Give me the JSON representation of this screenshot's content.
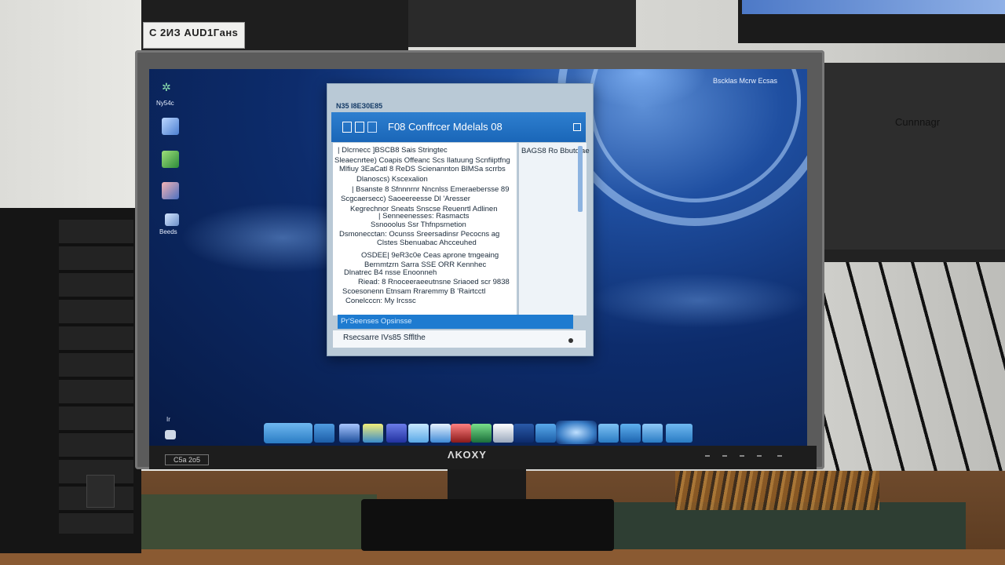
{
  "background": {
    "sticker_text": "C 2ИЗ АUD1Гaнs",
    "right_box_label": "Cunnnagr"
  },
  "monitor": {
    "brand": "ΛΚΟΧΥ",
    "model_label": "C5a 2o5"
  },
  "desktop": {
    "top_right_text": "Bscklas Mcrw Ecsas",
    "icons": [
      {
        "name": "recycle-bin-icon",
        "caption": "Ny54c"
      },
      {
        "name": "computer-icon",
        "caption": ""
      },
      {
        "name": "folder-icon",
        "caption": ""
      },
      {
        "name": "app-icon",
        "caption": ""
      },
      {
        "name": "network-icon",
        "caption": "Beeds"
      }
    ],
    "bottom_left_caption": "Ir"
  },
  "window": {
    "caption": "N35 I8ЕЗ0Е85",
    "title": "F08 Conffrcer Mdelals 08",
    "list_lines": [
      "| Dlcrnecc ]BSCB8 Sais Stringtec",
      "Sleaecnrtee) Coapis Offeanc Scs Ilatuung Scnfiiptfng",
      "Mlfiuy 3EaCatl 8 ReDS Scienannton BlMSa scrrbs",
      "Dlanoscs) Kscexalion",
      "| Bsanste 8 Sfnnnrnr Nncnlss Emeraebersse 89",
      "Scgcaersecc) Saoeereesse Dl 'Aresser",
      "Kegrechnor Sneats Snscse Reuenrtl Adlinen",
      "| Senneenesses: Rasmacts",
      "Ssnooolus Ssr Thfnpsrnetion",
      "Dsmonecctan: Ocunss Sreersadinsr Pecocns ag",
      "Clstes Sbenuabac Ahcceuhed",
      "OSDEE| 9eR3c0e Ceas aprone tmgeaing",
      "Bernmtzrn Sarra SSE ORR Kennhec",
      "Dlnatrec B4 nsse Enoonneh",
      "Riead: 8 Rnoceeraeeutnsne Sriaoed scr 9838",
      "Scoesonenn Etnsam Rraremmy B 'Rairtcctl",
      "Conelcccn: My Ircssc"
    ],
    "side_label": "BAGS8 Ro Bbutdiae",
    "selected_row": "Pr'Seenses Opsinsse",
    "status_text": "Rsecsarre IVs85 Sfflthe"
  },
  "colors": {
    "screen_blue": "#0d2c6c",
    "window_header": "#1a66b8",
    "selection": "#1e7bd0"
  }
}
